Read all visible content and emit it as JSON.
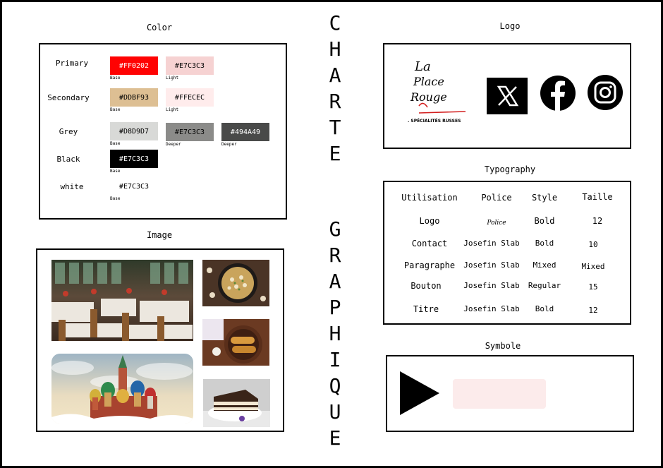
{
  "vertical_title": {
    "word1": [
      "C",
      "H",
      "A",
      "R",
      "T",
      "E"
    ],
    "word2": [
      "G",
      "R",
      "A",
      "P",
      "H",
      "I",
      "Q",
      "U",
      "E"
    ]
  },
  "color": {
    "title": "Color",
    "rows": [
      {
        "label": "Primary",
        "swatches": [
          {
            "hex": "#FF0202",
            "bg": "#FF0202",
            "fg": "#ffffff",
            "sub": "Base"
          },
          {
            "hex": "#E7C3C3",
            "bg": "#F6D2D2",
            "fg": "#000000",
            "sub": "Light"
          }
        ]
      },
      {
        "label": "Secondary",
        "swatches": [
          {
            "hex": "#DDBF93",
            "bg": "#DDBF93",
            "fg": "#000000",
            "sub": "Base"
          },
          {
            "hex": "#FFECEC",
            "bg": "#FFECEC",
            "fg": "#000000",
            "sub": "Light"
          }
        ]
      },
      {
        "label": "Grey",
        "swatches": [
          {
            "hex": "#D8D9D7",
            "bg": "#D8D9D7",
            "fg": "#000000",
            "sub": "Base"
          },
          {
            "hex": "#E7C3C3",
            "bg": "#8B8B89",
            "fg": "#000000",
            "sub": "Deeper"
          },
          {
            "hex": "#494A49",
            "bg": "#494A49",
            "fg": "#ffffff",
            "sub": "Deeper"
          }
        ]
      },
      {
        "label": "Black",
        "swatches": [
          {
            "hex": "#E7C3C3",
            "bg": "#000000",
            "fg": "#ffffff",
            "sub": "Base"
          }
        ]
      },
      {
        "label": "white",
        "swatches": [
          {
            "hex": "#E7C3C3",
            "bg": "#ffffff",
            "fg": "#000000",
            "sub": "Base"
          }
        ]
      }
    ]
  },
  "image": {
    "title": "Image",
    "photos": [
      "restaurant-interior",
      "mushroom-skillet",
      "stuffed-crepes",
      "saint-basil-cathedral",
      "layered-cake"
    ]
  },
  "logo": {
    "title": "Logo",
    "brand_line1": "La",
    "brand_line2": "Place",
    "brand_line3": "Rouge",
    "tagline": ". SPÉCIALITÉS RUSSES",
    "icons": [
      "x-icon",
      "facebook-icon",
      "instagram-icon"
    ]
  },
  "typography": {
    "title": "Typography",
    "headers": [
      "Utilisation",
      "Police",
      "Style",
      "Taille"
    ],
    "rows": [
      {
        "use": "Logo",
        "font": "Police",
        "style": "Bold",
        "size": "12"
      },
      {
        "use": "Contact",
        "font": "Josefin Slab",
        "style": "Bold",
        "size": "10"
      },
      {
        "use": "Paragraphe",
        "font": "Josefin Slab",
        "style": "Mixed",
        "size": "Mixed"
      },
      {
        "use": "Bouton",
        "font": "Josefin Slab",
        "style": "Regular",
        "size": "15"
      },
      {
        "use": "Titre",
        "font": "Josefin Slab",
        "style": "Bold",
        "size": "12"
      }
    ]
  },
  "symbole": {
    "title": "Symbole",
    "play_color": "#000000",
    "button_color": "#FCEBEB"
  }
}
